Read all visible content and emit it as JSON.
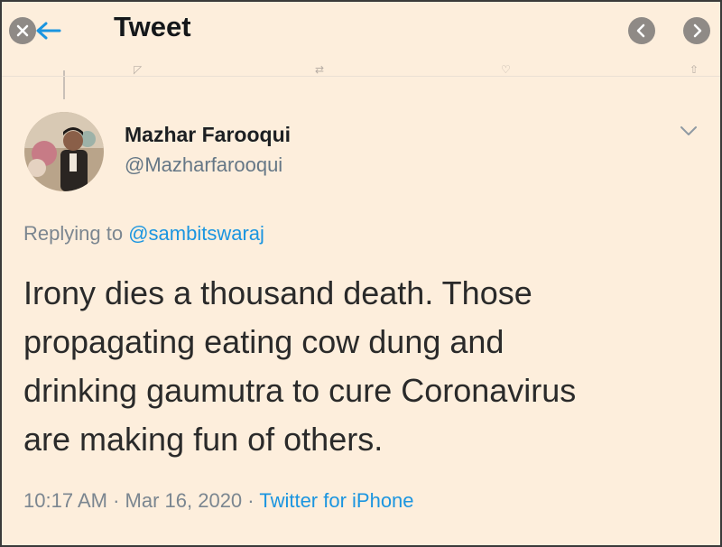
{
  "header": {
    "title": "Tweet",
    "close_icon": "close-icon",
    "back_icon": "back-arrow-icon",
    "prev_icon": "chevron-left-icon",
    "next_icon": "chevron-right-icon"
  },
  "author": {
    "name": "Mazhar Farooqui",
    "handle": "@Mazharfarooqui",
    "avatar_icon": "avatar",
    "menu_icon": "chevron-down-icon"
  },
  "reply": {
    "prefix": "Replying to",
    "mention": "@sambitswaraj"
  },
  "tweet": {
    "lines": [
      "Irony dies a thousand death. Those",
      "propagating eating cow dung and",
      "drinking gaumutra to cure Coronavirus",
      "are making fun of others."
    ]
  },
  "meta": {
    "time": "10:17 AM",
    "separator": "·",
    "date": "Mar 16, 2020",
    "source": "Twitter for iPhone"
  },
  "colors": {
    "background": "#fdeedc",
    "link": "#1b95e0",
    "secondary_text": "#7b8690"
  }
}
